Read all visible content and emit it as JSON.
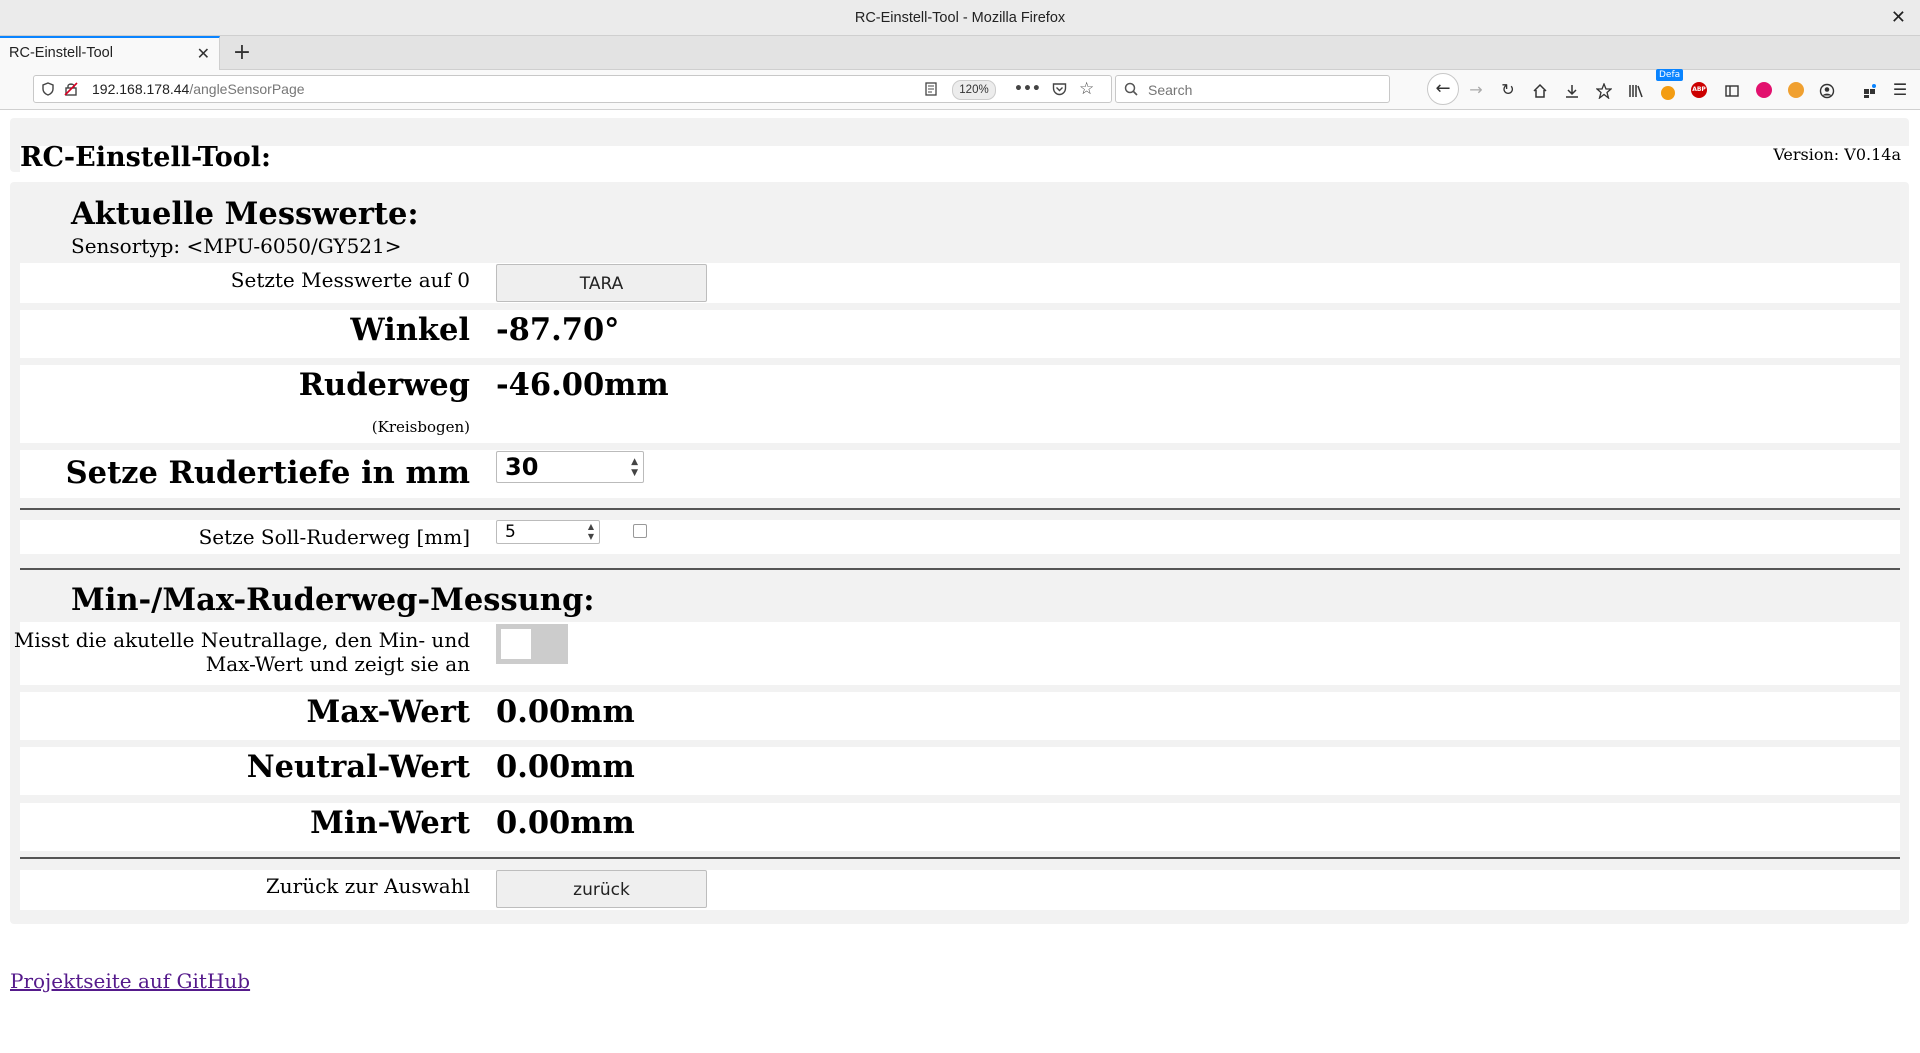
{
  "window": {
    "title": "RC-Einstell-Tool - Mozilla Firefox",
    "close_glyph": "✕"
  },
  "tabs": [
    {
      "label": "RC-Einstell-Tool",
      "close_glyph": "✕"
    }
  ],
  "new_tab_glyph": "+",
  "urlbar": {
    "host": "192.168.178.44",
    "path": "/angleSensorPage",
    "zoom": "120%"
  },
  "search": {
    "placeholder": "Search"
  },
  "toolbar": {
    "badge_label": "Defa",
    "abp_label": "ABP"
  },
  "page": {
    "header": {
      "title": "RC-Einstell-Tool:",
      "version": "Version: V0.14a"
    },
    "measurements": {
      "title": "Aktuelle Messwerte:",
      "sensor_type": "Sensortyp: <MPU-6050/GY521>",
      "tara_label": "Setzte Messwerte auf 0",
      "tara_button": "TARA",
      "angle_label": "Winkel",
      "angle_value": "-87.70°",
      "rudder_label": "Ruderweg",
      "rudder_value": "-46.00mm",
      "rudder_note": "(Kreisbogen)",
      "depth_label": "Setze Rudertiefe in mm",
      "depth_value": "30",
      "target_label": "Setze Soll-Ruderweg [mm]",
      "target_value": "5",
      "target_checked": false
    },
    "minmax": {
      "title": "Min-/Max-Ruderweg-Messung:",
      "toggle_label_1": "Misst die akutelle Neutrallage, den Min- und",
      "toggle_label_2": "Max-Wert und zeigt sie an",
      "toggle_on": false,
      "max_label": "Max-Wert",
      "max_value": "0.00mm",
      "neutral_label": "Neutral-Wert",
      "neutral_value": "0.00mm",
      "min_label": "Min-Wert",
      "min_value": "0.00mm"
    },
    "back_label": "Zurück zur Auswahl",
    "back_button": "zurück",
    "github_link": "Projektseite auf GitHub"
  }
}
